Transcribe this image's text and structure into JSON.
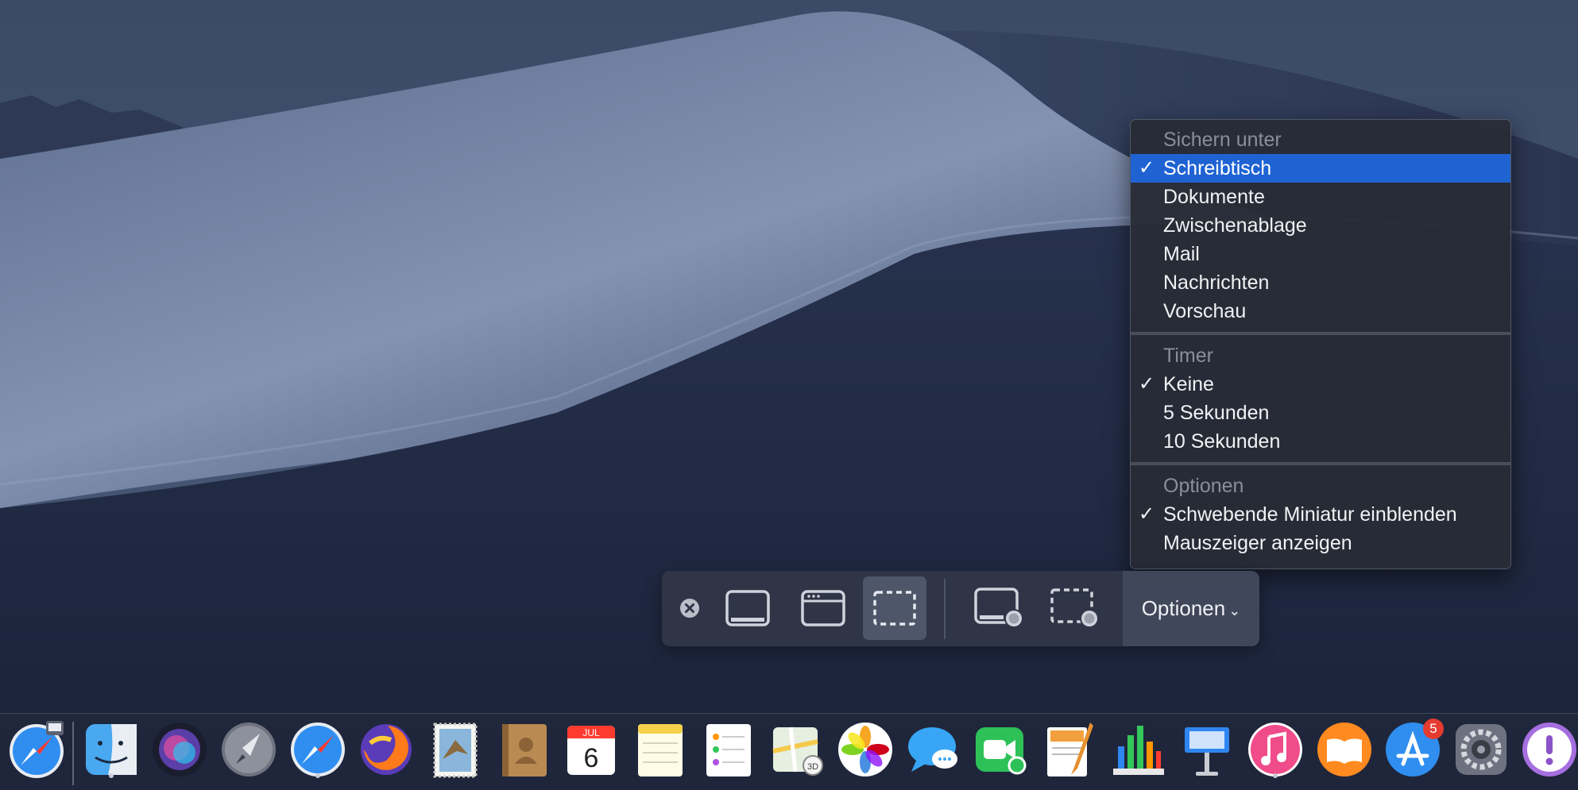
{
  "menu": {
    "save_header": "Sichern unter",
    "save_items": [
      {
        "label": "Schreibtisch",
        "checked": true,
        "highlighted": true
      },
      {
        "label": "Dokumente",
        "checked": false
      },
      {
        "label": "Zwischenablage",
        "checked": false
      },
      {
        "label": "Mail",
        "checked": false
      },
      {
        "label": "Nachrichten",
        "checked": false
      },
      {
        "label": "Vorschau",
        "checked": false
      }
    ],
    "timer_header": "Timer",
    "timer_items": [
      {
        "label": "Keine",
        "checked": true
      },
      {
        "label": "5 Sekunden",
        "checked": false
      },
      {
        "label": "10 Sekunden",
        "checked": false
      }
    ],
    "options_header": "Optionen",
    "options_items": [
      {
        "label": "Schwebende Miniatur einblenden",
        "checked": true
      },
      {
        "label": "Mauszeiger anzeigen",
        "checked": false
      }
    ],
    "check_glyph": "✓"
  },
  "toolbar": {
    "options_label": "Optionen",
    "chevron": "⌄"
  },
  "dock": {
    "calendar_month": "JUL",
    "calendar_day": "6",
    "appstore_badge": "5"
  },
  "colors": {
    "highlight": "#1f63d3",
    "badge": "#e63b30"
  }
}
